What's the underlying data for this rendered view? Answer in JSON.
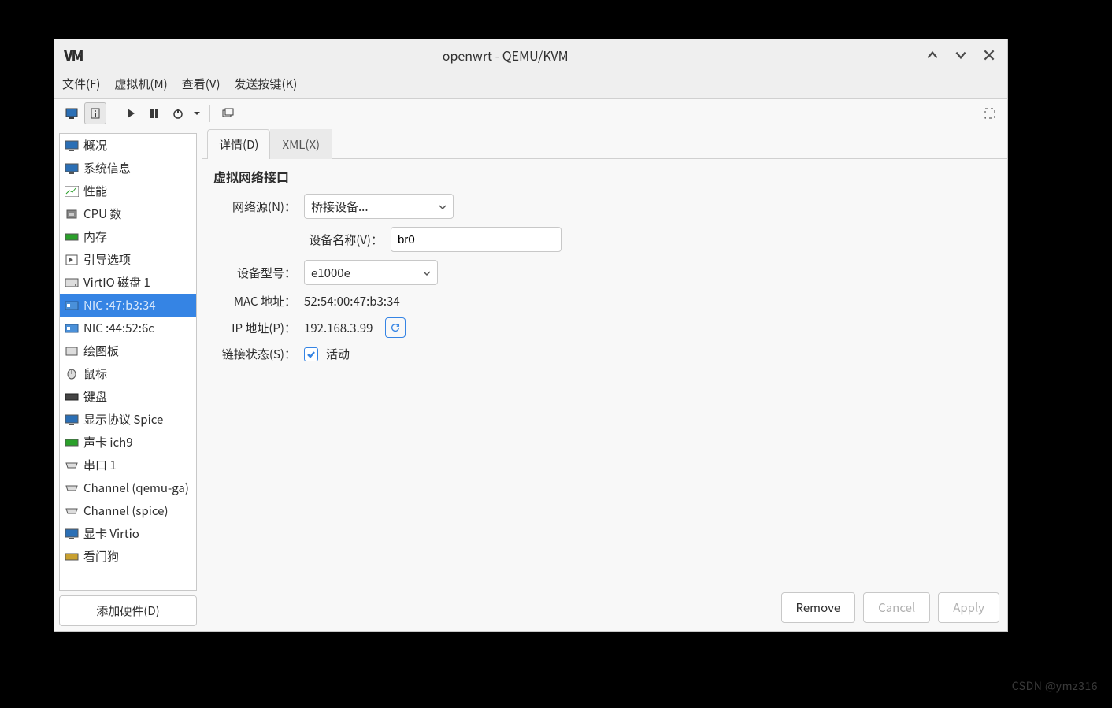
{
  "window": {
    "logo": "VM",
    "title": "openwrt - QEMU/KVM"
  },
  "menubar": {
    "file": "文件(F)",
    "vm": "虚拟机(M)",
    "view": "查看(V)",
    "sendkeys": "发送按键(K)"
  },
  "sidebar": {
    "items": [
      {
        "label": "概况"
      },
      {
        "label": "系统信息"
      },
      {
        "label": "性能"
      },
      {
        "label": "CPU 数"
      },
      {
        "label": "内存"
      },
      {
        "label": "引导选项"
      },
      {
        "label": "VirtIO 磁盘 1"
      },
      {
        "label": "NIC :47:b3:34"
      },
      {
        "label": "NIC :44:52:6c"
      },
      {
        "label": "绘图板"
      },
      {
        "label": "鼠标"
      },
      {
        "label": "键盘"
      },
      {
        "label": "显示协议 Spice"
      },
      {
        "label": "声卡 ich9"
      },
      {
        "label": "串口 1"
      },
      {
        "label": "Channel (qemu-ga)"
      },
      {
        "label": "Channel (spice)"
      },
      {
        "label": "显卡 Virtio"
      },
      {
        "label": "看门狗"
      }
    ],
    "add_hw": "添加硬件(D)"
  },
  "tabs": {
    "details": "详情(D)",
    "xml": "XML(X)"
  },
  "details": {
    "section_title": "虚拟网络接口",
    "net_source_label": "网络源(N)：",
    "net_source_value": "桥接设备...",
    "device_name_label": "设备名称(V)：",
    "device_name_value": "br0",
    "device_model_label": "设备型号：",
    "device_model_value": "e1000e",
    "mac_label": "MAC 地址：",
    "mac_value": "52:54:00:47:b3:34",
    "ip_label": "IP 地址(P)：",
    "ip_value": "192.168.3.99",
    "link_state_label": "链接状态(S)：",
    "link_state_value": "活动"
  },
  "footer": {
    "remove": "Remove",
    "cancel": "Cancel",
    "apply": "Apply"
  },
  "watermark": "CSDN @ymz316"
}
